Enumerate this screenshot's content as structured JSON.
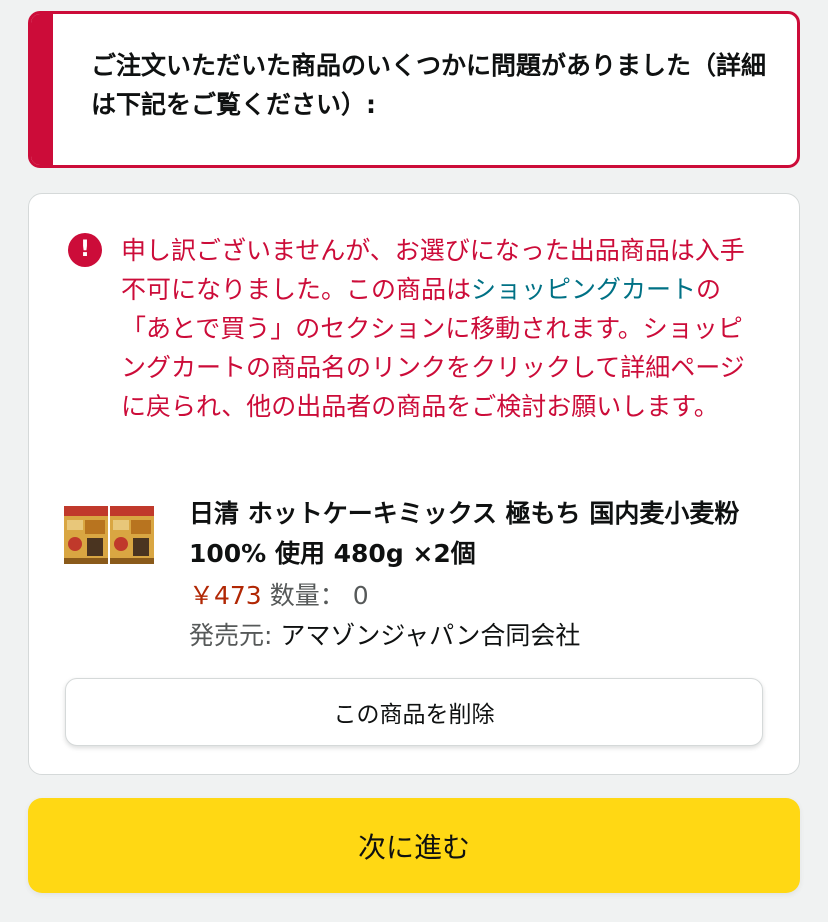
{
  "alert": {
    "title": "ご注文いただいた商品のいくつかに問題がありました（詳細は下記をご覧ください）:"
  },
  "error": {
    "icon": "exclamation-circle-icon",
    "text_before_link": "申し訳ございませんが、お選びになった出品商品は入手不可になりました。この商品は",
    "link_text": "ショッピングカート",
    "text_after_link": "の「あとで買う」のセクションに移動されます。ショッピングカートの商品名のリンクをクリックして詳細ページに戻られ、他の出品者の商品をご検討お願いします。"
  },
  "product": {
    "title": "日清 ホットケーキミックス 極もち 国内麦小麦粉 100% 使用 480g ×2個",
    "price": "￥473",
    "quantity_label": "数量：",
    "quantity_value": "0",
    "seller_label": "発売元:",
    "seller_name": "アマゾンジャパン合同会社",
    "thumb_text": "極もち"
  },
  "buttons": {
    "delete_label": "この商品を削除",
    "continue_label": "次に進む"
  },
  "colors": {
    "alert": "#cc0c39",
    "link": "#007185",
    "price": "#b12704",
    "continue_bg": "#ffd814"
  }
}
